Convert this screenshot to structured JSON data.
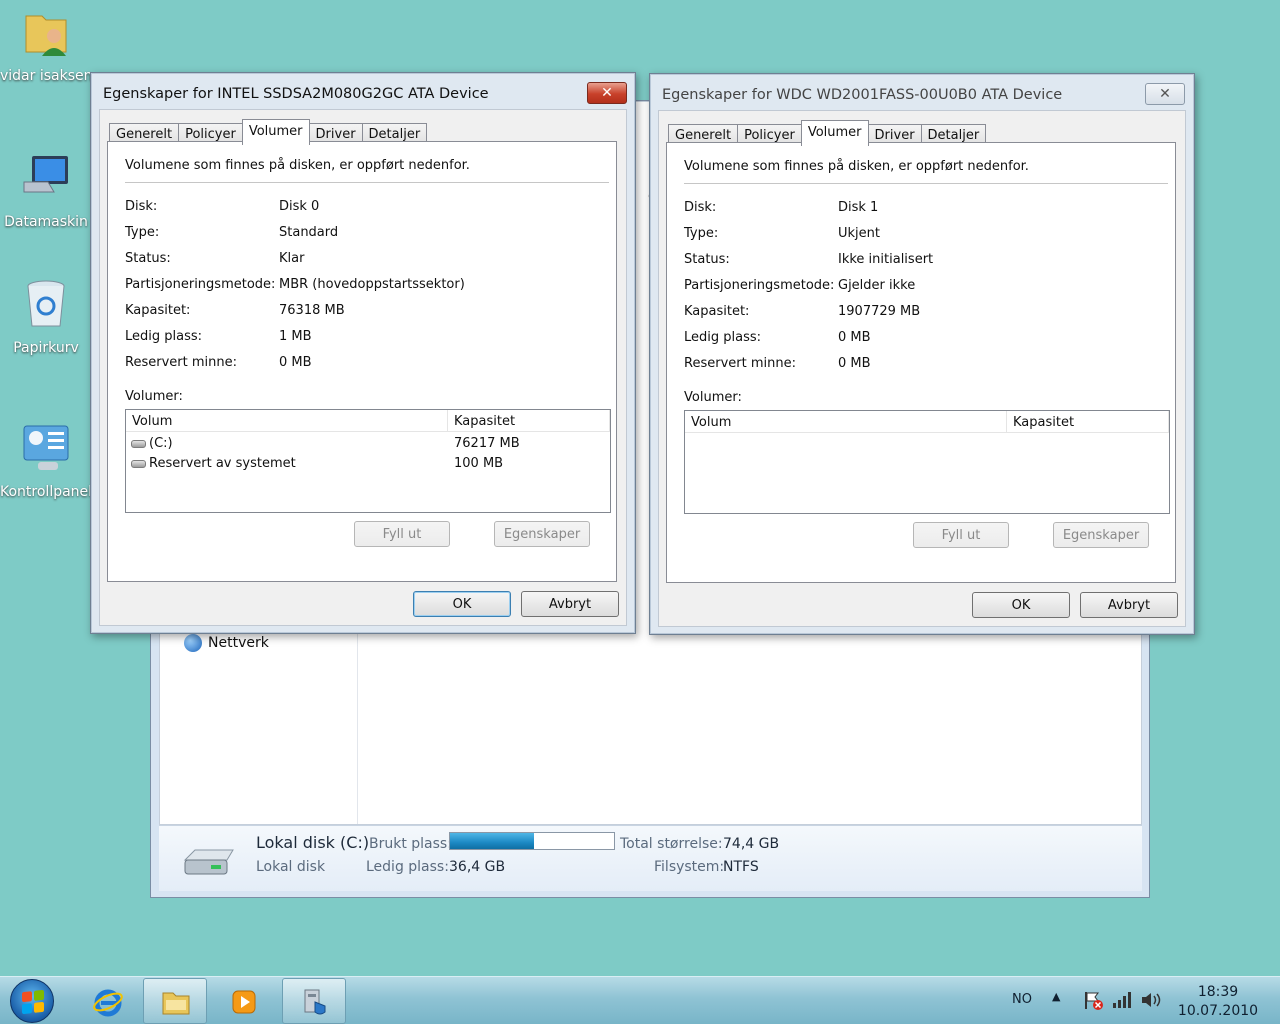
{
  "desktop": {
    "icons": [
      {
        "label": "vidar isaksen"
      },
      {
        "label": "Datamaskin"
      },
      {
        "label": "Papirkurv"
      },
      {
        "label": "Kontrollpanel"
      }
    ]
  },
  "explorer": {
    "nav_nettverk": "Nettverk",
    "partial_text": "el",
    "details": {
      "drive_name": "Lokal disk (C:)",
      "drive_type": "Lokal disk",
      "used_label": "Brukt plass:",
      "used_fraction": 0.51,
      "free_label": "Ledig plass:",
      "free_value": "36,4 GB",
      "total_label": "Total størrelse:",
      "total_value": "74,4 GB",
      "fs_label": "Filsystem:",
      "fs_value": "NTFS"
    }
  },
  "dialog1": {
    "title": "Egenskaper for INTEL SSDSA2M080G2GC ATA Device",
    "close": "✕",
    "tabs": [
      "Generelt",
      "Policyer",
      "Volumer",
      "Driver",
      "Detaljer"
    ],
    "intro": "Volumene som finnes på disken, er oppført nedenfor.",
    "fields": [
      {
        "label": "Disk:",
        "value": "Disk 0"
      },
      {
        "label": "Type:",
        "value": "Standard"
      },
      {
        "label": "Status:",
        "value": "Klar"
      },
      {
        "label": "Partisjoneringsmetode:",
        "value": "MBR (hovedoppstartssektor)"
      },
      {
        "label": "Kapasitet:",
        "value": "76318 MB"
      },
      {
        "label": "Ledig plass:",
        "value": "1 MB"
      },
      {
        "label": "Reservert minne:",
        "value": "0 MB"
      }
    ],
    "volumes_label": "Volumer:",
    "col_volume": "Volum",
    "col_capacity": "Kapasitet",
    "volumes": [
      {
        "name": "(C:)",
        "capacity": "76217 MB"
      },
      {
        "name": "Reservert av systemet",
        "capacity": "100 MB"
      }
    ],
    "btn_fill": "Fyll ut",
    "btn_props": "Egenskaper",
    "btn_ok": "OK",
    "btn_cancel": "Avbryt"
  },
  "dialog2": {
    "title": "Egenskaper for WDC WD2001FASS-00U0B0 ATA Device",
    "close": "✕",
    "tabs": [
      "Generelt",
      "Policyer",
      "Volumer",
      "Driver",
      "Detaljer"
    ],
    "intro": "Volumene som finnes på disken, er oppført nedenfor.",
    "fields": [
      {
        "label": "Disk:",
        "value": "Disk 1"
      },
      {
        "label": "Type:",
        "value": "Ukjent"
      },
      {
        "label": "Status:",
        "value": "Ikke initialisert"
      },
      {
        "label": "Partisjoneringsmetode:",
        "value": "Gjelder ikke"
      },
      {
        "label": "Kapasitet:",
        "value": "1907729 MB"
      },
      {
        "label": "Ledig plass:",
        "value": "0 MB"
      },
      {
        "label": "Reservert minne:",
        "value": "0 MB"
      }
    ],
    "volumes_label": "Volumer:",
    "col_volume": "Volum",
    "col_capacity": "Kapasitet",
    "btn_fill": "Fyll ut",
    "btn_props": "Egenskaper",
    "btn_ok": "OK",
    "btn_cancel": "Avbryt"
  },
  "taskbar": {
    "lang": "NO",
    "time": "18:39",
    "date": "10.07.2010"
  }
}
